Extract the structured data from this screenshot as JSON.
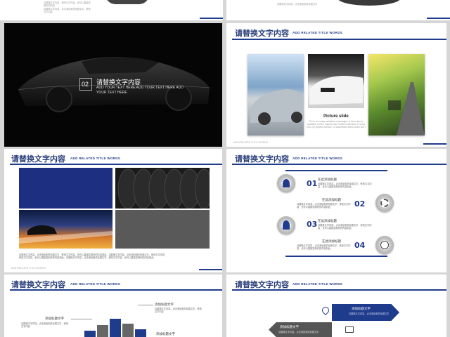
{
  "slides": {
    "top_left": {
      "text1": "请替换文字内容，修改文字内容，也可以直接复制你的内容",
      "text2": "请替换文字内容，点击添加相关标题文字，修改文字内容"
    },
    "top_right": {
      "text1": "请替换文字内容，点击添加相关标题文字"
    },
    "car_dark": {
      "number": "02",
      "title": "请替换文字内容",
      "subtitle1": "ADD YOUR TEXT HERE ADD YOUR TEXT HERE ADD",
      "subtitle2": "YOUR TEXT HERE"
    },
    "photos": {
      "title": "请替换文字内容",
      "subtitle": "ADD RELATED TITLE WORDS",
      "caption_title": "Picture slide",
      "caption_text": "There are many variations of passages of lorem ipsum available, but the majority have suffered alteration in some form, by injected humour, or randomised words which don't",
      "footer": "ADD RELATED TITLE WORDS"
    },
    "tires": {
      "title": "请替换文字内容",
      "subtitle": "ADD RELATED TITLE WORDS",
      "body1": "请替换文字内容，点击添加相关标题文字，修改文字内容，也可以直接复制你的内容到此。请替换文字内容，点击添加相关标题文字，修改文字内容",
      "body2": "修改文字内容，也可以直接复制你的内容到此。请替换文字内容，点击添加相关标题文字，修改文字内容，也可以直接复制你的内容到此。",
      "footer": "ADD RELATED TITLE WORDS"
    },
    "steps": {
      "title": "请替换文字内容",
      "subtitle": "ADD RELATED TITLE WORDS",
      "items": [
        {
          "num": "01",
          "label": "在此添加标题",
          "text": "请替换文字内容，点击添加相关标题文字，修改文字内容，也可以直接复制你的内容到此。"
        },
        {
          "num": "02",
          "label": "在此添加标题",
          "text": "请替换文字内容，点击添加相关标题文字，修改文字内容，也可以直接复制你的内容到此。"
        },
        {
          "num": "03",
          "label": "在此添加标题",
          "text": "请替换文字内容，点击添加相关标题文字，修改文字内容，也可以直接复制你的内容到此。"
        },
        {
          "num": "04",
          "label": "在此添加标题",
          "text": "请替换文字内容，点击添加相关标题文字，修改文字内容，也可以直接复制你的内容到此。"
        }
      ]
    },
    "bars": {
      "title": "请替换文字内容",
      "subtitle": "ADD RELATED TITLE WORDS",
      "label_a": "添加标题文字",
      "label_b": "添加标题文字",
      "label_c": "添加标题文字",
      "text": "请替换文字内容，点击添加相关标题文字，修改文字内容"
    },
    "arrows": {
      "title": "请替换文字内容",
      "subtitle": "ADD RELATED TITLE WORDS",
      "label_a": "添加标题文字",
      "label_b": "添加标题文字",
      "text": "请替换文字内容，点击添加相关标题文字"
    }
  }
}
